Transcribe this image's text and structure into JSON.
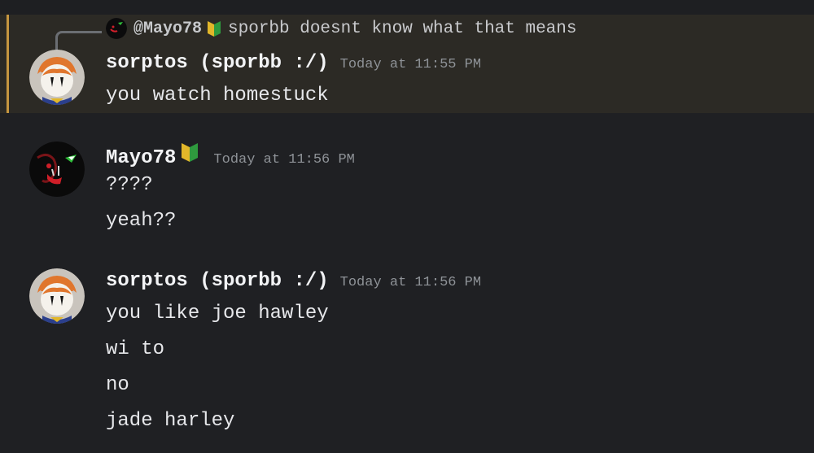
{
  "colors": {
    "background": "#1f2023",
    "highlight_bg": "#2c2a25",
    "highlight_bar": "#c6963f",
    "username": "#f2f3f5",
    "timestamp": "#8e9297",
    "text": "#e6e7ea"
  },
  "messages": [
    {
      "reply_to": {
        "author": "@Mayo78",
        "badge_icon": "beginner-badge-icon",
        "text": "sporbb doesnt know what that means"
      },
      "author": "sorptos (sporbb :/)",
      "timestamp": "Today at 11:55 PM",
      "avatar_icon": "sorptos-avatar-icon",
      "lines": [
        "you watch homestuck"
      ]
    },
    {
      "author": "Mayo78",
      "badge_icon": "beginner-badge-icon",
      "timestamp": "Today at 11:56 PM",
      "avatar_icon": "mayo78-avatar-icon",
      "lines": [
        "????",
        "yeah??"
      ]
    },
    {
      "author": "sorptos (sporbb :/)",
      "timestamp": "Today at 11:56 PM",
      "avatar_icon": "sorptos-avatar-icon",
      "lines": [
        "you like joe hawley",
        "wi to",
        "no",
        "jade harley"
      ]
    }
  ]
}
